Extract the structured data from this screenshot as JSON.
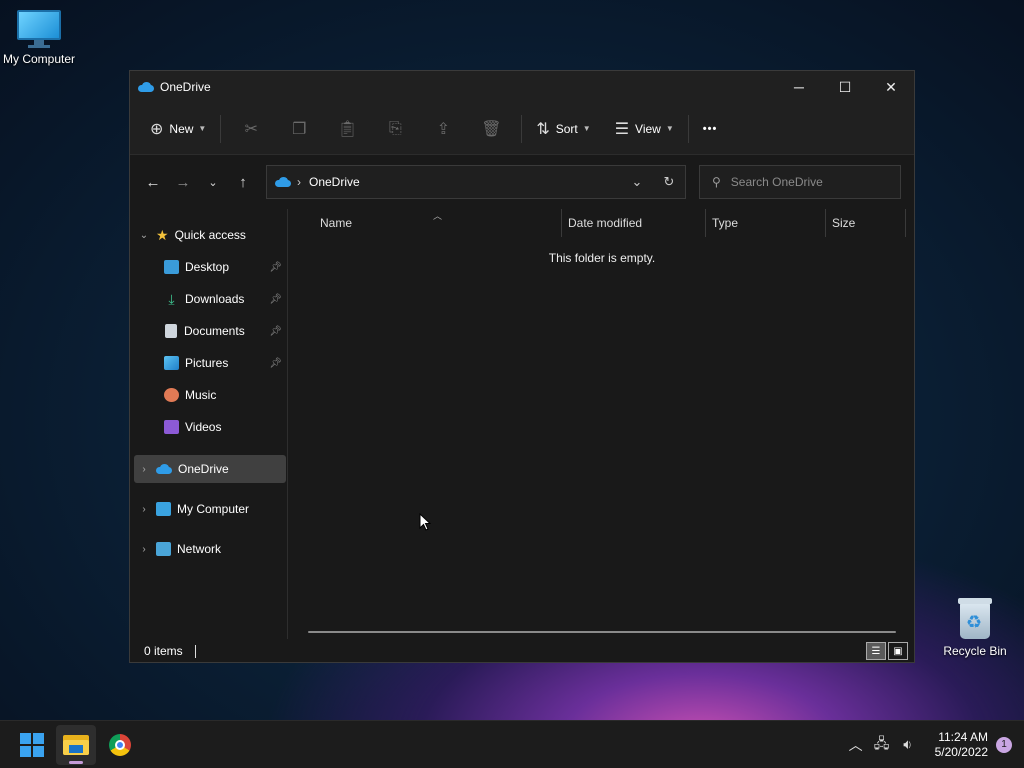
{
  "desktop": {
    "icons": [
      {
        "label": "My Computer"
      },
      {
        "label": "Recycle Bin"
      }
    ]
  },
  "window": {
    "title": "OneDrive",
    "controls": {
      "minimize": "─",
      "maximize": "☐",
      "close": "✕"
    }
  },
  "toolbar": {
    "new_label": "New",
    "sort_label": "Sort",
    "view_label": "View",
    "more_label": "•••"
  },
  "nav": {
    "address_crumb": "OneDrive",
    "search_placeholder": "Search OneDrive"
  },
  "sidebar": {
    "quick_access": "Quick access",
    "items": [
      {
        "label": "Desktop",
        "pinned": true
      },
      {
        "label": "Downloads",
        "pinned": true
      },
      {
        "label": "Documents",
        "pinned": true
      },
      {
        "label": "Pictures",
        "pinned": true
      },
      {
        "label": "Music",
        "pinned": false
      },
      {
        "label": "Videos",
        "pinned": false
      }
    ],
    "onedrive": "OneDrive",
    "my_computer": "My Computer",
    "network": "Network"
  },
  "filelist": {
    "columns": [
      "Name",
      "Date modified",
      "Type",
      "Size"
    ],
    "empty_message": "This folder is empty."
  },
  "status": {
    "item_count": "0 items"
  },
  "taskbar": {
    "time": "11:24 AM",
    "date": "5/20/2022",
    "notification_count": "1"
  },
  "colors": {
    "accent": "#2f9ce8",
    "window_bg": "#191919",
    "toolbar_bg": "#202020",
    "selected_bg": "#404040"
  }
}
